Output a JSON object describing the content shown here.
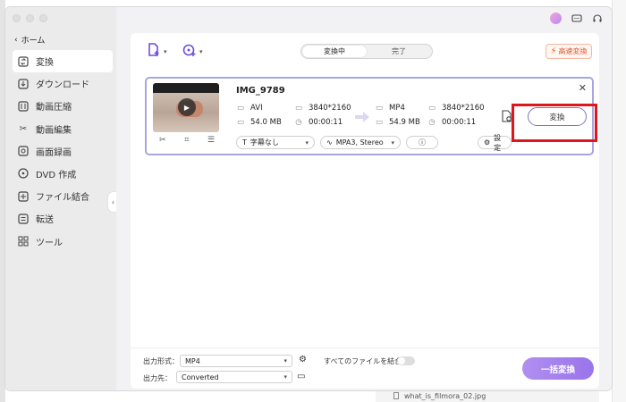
{
  "sidebar": {
    "back_label": "ホーム",
    "items": [
      {
        "label": "変換",
        "icon": "convert-icon",
        "active": true
      },
      {
        "label": "ダウンロード",
        "icon": "download-icon",
        "active": false
      },
      {
        "label": "動画圧縮",
        "icon": "compress-icon",
        "active": false
      },
      {
        "label": "動画編集",
        "icon": "scissors-icon",
        "active": false
      },
      {
        "label": "画面録画",
        "icon": "record-icon",
        "active": false
      },
      {
        "label": "DVD 作成",
        "icon": "dvd-icon",
        "active": false
      },
      {
        "label": "ファイル結合",
        "icon": "merge-icon",
        "active": false
      },
      {
        "label": "転送",
        "icon": "transfer-icon",
        "active": false
      },
      {
        "label": "ツール",
        "icon": "tools-icon",
        "active": false
      }
    ]
  },
  "tabs": {
    "converting": "変換中",
    "done": "完了"
  },
  "fast_convert_label": "高速変換",
  "file": {
    "title": "IMG_9789",
    "source": {
      "format": "AVI",
      "resolution": "3840*2160",
      "size": "54.0 MB",
      "duration": "00:00:11"
    },
    "output": {
      "format": "MP4",
      "resolution": "3840*2160",
      "size": "54.9 MB",
      "duration": "00:00:11"
    },
    "subtitle": "字幕なし",
    "audio": "MPA3, Stereo",
    "settings_label": "設定",
    "convert_label": "変換"
  },
  "bottom": {
    "output_format_label": "出力形式：",
    "output_format_value": "MP4",
    "merge_label": "すべてのファイルを結合",
    "output_dest_label": "出力先：",
    "output_dest_value": "Converted",
    "convert_all_label": "一括変換"
  },
  "background": {
    "finder_file": "what_is_filmora_02.jpg"
  },
  "colors": {
    "accent": "#6d4de0",
    "convert_all": "#a17ded",
    "highlight": "#e3151c",
    "fast_convert": "#f05a24"
  }
}
